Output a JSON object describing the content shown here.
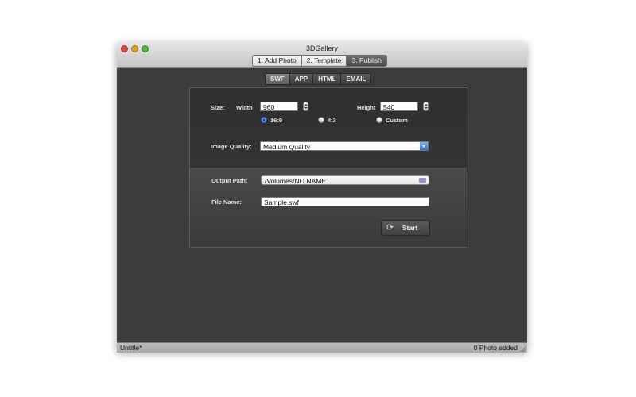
{
  "window": {
    "title": "3DGallery"
  },
  "steps": [
    {
      "label": "1. Add Photo",
      "active": false
    },
    {
      "label": "2. Template",
      "active": false
    },
    {
      "label": "3. Publish",
      "active": true
    }
  ],
  "tabs": [
    {
      "label": "SWF",
      "active": true
    },
    {
      "label": "APP",
      "active": false
    },
    {
      "label": "HTML",
      "active": false
    },
    {
      "label": "EMAIL",
      "active": false
    }
  ],
  "size": {
    "label": "Size:",
    "width_label": "Width",
    "width_value": "960",
    "height_label": "Height",
    "height_value": "540",
    "ratio_options": [
      {
        "label": "16:9",
        "checked": true
      },
      {
        "label": "4:3",
        "checked": false
      },
      {
        "label": "Custom",
        "checked": false
      }
    ]
  },
  "quality": {
    "label": "Image Quality:",
    "value": "Medium Quality"
  },
  "output": {
    "label": "Output Path:",
    "value": "/Volumes/NO NAME"
  },
  "filename": {
    "label": "File Name:",
    "value": "Sample.swf"
  },
  "start_button": {
    "label": "Start"
  },
  "status": {
    "left": "Untitle*",
    "right": "0 Photo added"
  },
  "colors": {
    "accent": "#3b7de0",
    "panel": "#353535",
    "background": "#3c3c3c"
  }
}
